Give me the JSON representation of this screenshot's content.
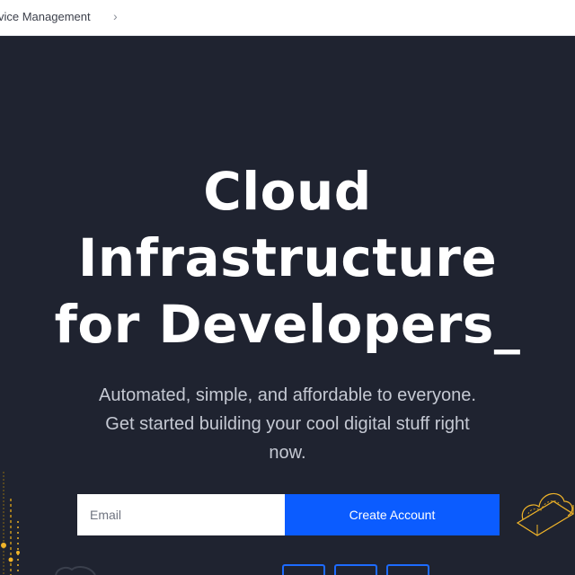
{
  "breadcrumb": {
    "label": "vice Management",
    "separator": "›"
  },
  "hero": {
    "title_lines": [
      "Cloud",
      "Infrastructure",
      "for Developers"
    ],
    "cursor": "_",
    "subtitle": "Automated, simple, and affordable to everyone. Get started building your cool digital stuff right now."
  },
  "signup": {
    "email_placeholder": "Email",
    "button_label": "Create Account"
  },
  "colors": {
    "background": "#1f2330",
    "accent": "#0b5cff",
    "decoration": "#f0b429"
  },
  "icons": [
    "chevron-right-icon",
    "circuit-decoration",
    "cloud-wireframe-decoration"
  ]
}
